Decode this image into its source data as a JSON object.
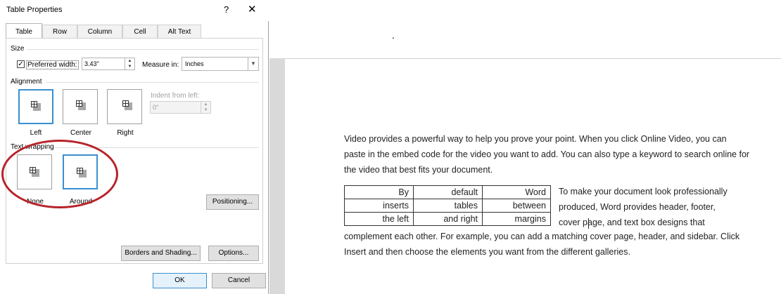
{
  "dialog": {
    "title": "Table Properties",
    "help_label": "?",
    "close_label": "✕",
    "tabs": [
      {
        "label": "Table",
        "active": true
      },
      {
        "label": "Row",
        "active": false
      },
      {
        "label": "Column",
        "active": false
      },
      {
        "label": "Cell",
        "active": false
      },
      {
        "label": "Alt Text",
        "active": false
      }
    ],
    "size": {
      "section_label": "Size",
      "preferred_width_checked": true,
      "preferred_width_label": "Preferred width:",
      "preferred_width_value": "3.43\"",
      "measure_in_label": "Measure in:",
      "measure_in_value": "Inches"
    },
    "alignment": {
      "section_label": "Alignment",
      "options": [
        "Left",
        "Center",
        "Right"
      ],
      "selected": "Left",
      "indent_label": "Indent from left:",
      "indent_value": "0\""
    },
    "text_wrapping": {
      "section_label": "Text wrapping",
      "options": [
        "None",
        "Around"
      ],
      "selected": "Around",
      "positioning_button": "Positioning..."
    },
    "buttons": {
      "borders_shading": "Borders and Shading...",
      "options": "Options...",
      "ok": "OK",
      "cancel": "Cancel"
    },
    "highlight_color": "#b7232a",
    "accent_color": "#3a8fd0"
  },
  "document": {
    "top_marker": ".",
    "paragraph1_lines": [
      "Video provides a powerful way to help you prove your point. When you click Online Video, you can",
      "paste in the embed code for the video you want to add. You can also type a keyword to search online for",
      "the video that best fits your document."
    ],
    "table_rows": [
      [
        "By",
        "default",
        "Word"
      ],
      [
        "inserts",
        "tables",
        "between"
      ],
      [
        "the left",
        "and right",
        "margins"
      ]
    ],
    "wrap_lines": [
      "To make your document look professionally",
      "produced, Word provides header, footer,",
      "cover page, and text box designs that"
    ],
    "paragraph2_lines": [
      "complement each other. For example, you can add a matching cover page, header, and sidebar. Click",
      "Insert and then choose the elements you want from the different galleries."
    ]
  }
}
